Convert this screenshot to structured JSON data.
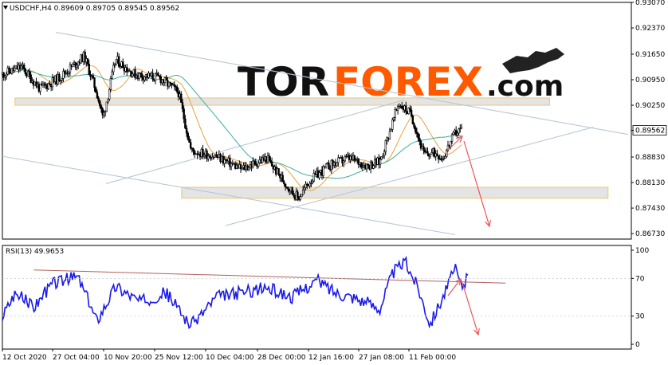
{
  "chart_data": {
    "type": "line",
    "symbol": "USDCHF",
    "timeframe": "H4",
    "header_text": "USDCHF,H4  0.89609 0.89705 0.89545 0.89562",
    "brand": {
      "name": "TORFOREX.com",
      "part1": "TOR",
      "part2": "FOREX",
      "part3": ".com"
    },
    "colors": {
      "candles": "#000000",
      "ma_fast": "#e8a33a",
      "ma_slow": "#3aaea0",
      "channel": "#b9c7d8",
      "zone_fill": "#e2e2e2",
      "zone_border": "#f0c060",
      "arrow": "#ee5555",
      "rsi_line": "#1a1aee",
      "rsi_trend": "#b06060",
      "logo_orange": "#ff5a00"
    },
    "price_axis": {
      "ylim": [
        0.8658,
        0.9307
      ],
      "ticks": [
        "0.93070",
        "0.92370",
        "0.91650",
        "0.90950",
        "0.90250",
        "0.89562",
        "0.88830",
        "0.88130",
        "0.87430",
        "0.86730"
      ],
      "tick_values": [
        0.9307,
        0.9237,
        0.9165,
        0.9095,
        0.9025,
        0.89562,
        0.8883,
        0.8813,
        0.8743,
        0.8673
      ],
      "current_price": "0.89562"
    },
    "time_axis": [
      "12 Oct 2020",
      "27 Oct 04:00",
      "10 Nov 20:00",
      "25 Nov 12:00",
      "10 Dec 04:00",
      "28 Dec 00:00",
      "12 Jan 16:00",
      "27 Jan 08:00",
      "11 Feb 00:00"
    ],
    "price_series_anchors": [
      [
        0,
        0.911
      ],
      [
        0.03,
        0.913
      ],
      [
        0.06,
        0.907
      ],
      [
        0.09,
        0.91
      ],
      [
        0.13,
        0.916
      ],
      [
        0.15,
        0.906
      ],
      [
        0.16,
        0.899
      ],
      [
        0.18,
        0.915
      ],
      [
        0.21,
        0.911
      ],
      [
        0.25,
        0.91
      ],
      [
        0.28,
        0.906
      ],
      [
        0.3,
        0.89
      ],
      [
        0.34,
        0.8885
      ],
      [
        0.38,
        0.885
      ],
      [
        0.42,
        0.888
      ],
      [
        0.45,
        0.881
      ],
      [
        0.47,
        0.877
      ],
      [
        0.49,
        0.882
      ],
      [
        0.52,
        0.886
      ],
      [
        0.55,
        0.888
      ],
      [
        0.58,
        0.886
      ],
      [
        0.6,
        0.887
      ],
      [
        0.63,
        0.903
      ],
      [
        0.65,
        0.9
      ],
      [
        0.67,
        0.889
      ],
      [
        0.69,
        0.8895
      ],
      [
        0.7,
        0.888
      ],
      [
        0.72,
        0.895
      ],
      [
        0.73,
        0.896
      ]
    ],
    "zones": [
      {
        "name": "resistance",
        "price_top": 0.9045,
        "price_bottom": 0.9025
      },
      {
        "name": "support",
        "price_top": 0.88,
        "price_bottom": 0.877
      }
    ],
    "rsi": {
      "label": "RSI(13) 49.9653",
      "period": 13,
      "value": 49.9653,
      "ylim": [
        0,
        100
      ],
      "ticks": [
        "100",
        "70",
        "30",
        "0"
      ],
      "tick_values": [
        100,
        70,
        30,
        0
      ],
      "series_anchors": [
        [
          0,
          30
        ],
        [
          0.02,
          55
        ],
        [
          0.05,
          40
        ],
        [
          0.08,
          65
        ],
        [
          0.12,
          72
        ],
        [
          0.15,
          25
        ],
        [
          0.18,
          62
        ],
        [
          0.22,
          45
        ],
        [
          0.26,
          55
        ],
        [
          0.3,
          20
        ],
        [
          0.34,
          50
        ],
        [
          0.38,
          55
        ],
        [
          0.42,
          60
        ],
        [
          0.46,
          50
        ],
        [
          0.5,
          68
        ],
        [
          0.53,
          55
        ],
        [
          0.56,
          50
        ],
        [
          0.6,
          38
        ],
        [
          0.62,
          75
        ],
        [
          0.64,
          88
        ],
        [
          0.66,
          62
        ],
        [
          0.68,
          22
        ],
        [
          0.7,
          50
        ],
        [
          0.72,
          80
        ],
        [
          0.73,
          62
        ],
        [
          0.74,
          70
        ]
      ]
    }
  }
}
